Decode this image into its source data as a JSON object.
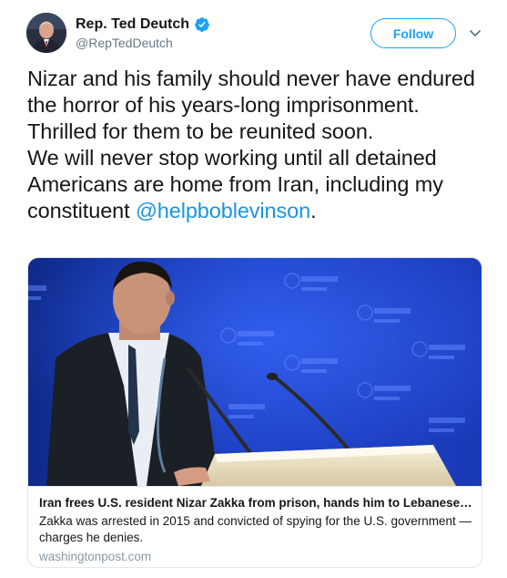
{
  "user": {
    "display_name": "Rep. Ted Deutch",
    "handle": "@RepTedDeutch",
    "verified_icon": "verified-badge-icon"
  },
  "actions": {
    "follow_label": "Follow",
    "menu_icon": "chevron-down-icon"
  },
  "tweet": {
    "paragraph_1": "Nizar and his family should never have endured the horror of his years-long imprisonment. Thrilled for them to be reunited soon.",
    "paragraph_2_text": "We will never stop working until all detained Americans are home from Iran, including my constituent ",
    "mention": "@helpboblevinson",
    "paragraph_2_end": "."
  },
  "card": {
    "title": "Iran frees U.S. resident Nizar Zakka from prison, hands him to Lebanese ...",
    "description": "Zakka was arrested in 2015 and convicted of spying for the U.S. government — charges he denies.",
    "domain": "washingtonpost.com"
  },
  "colors": {
    "link": "#1b95e0",
    "follow": "#1da1f2",
    "secondary_text": "#657786",
    "border": "#e1e8ed"
  }
}
